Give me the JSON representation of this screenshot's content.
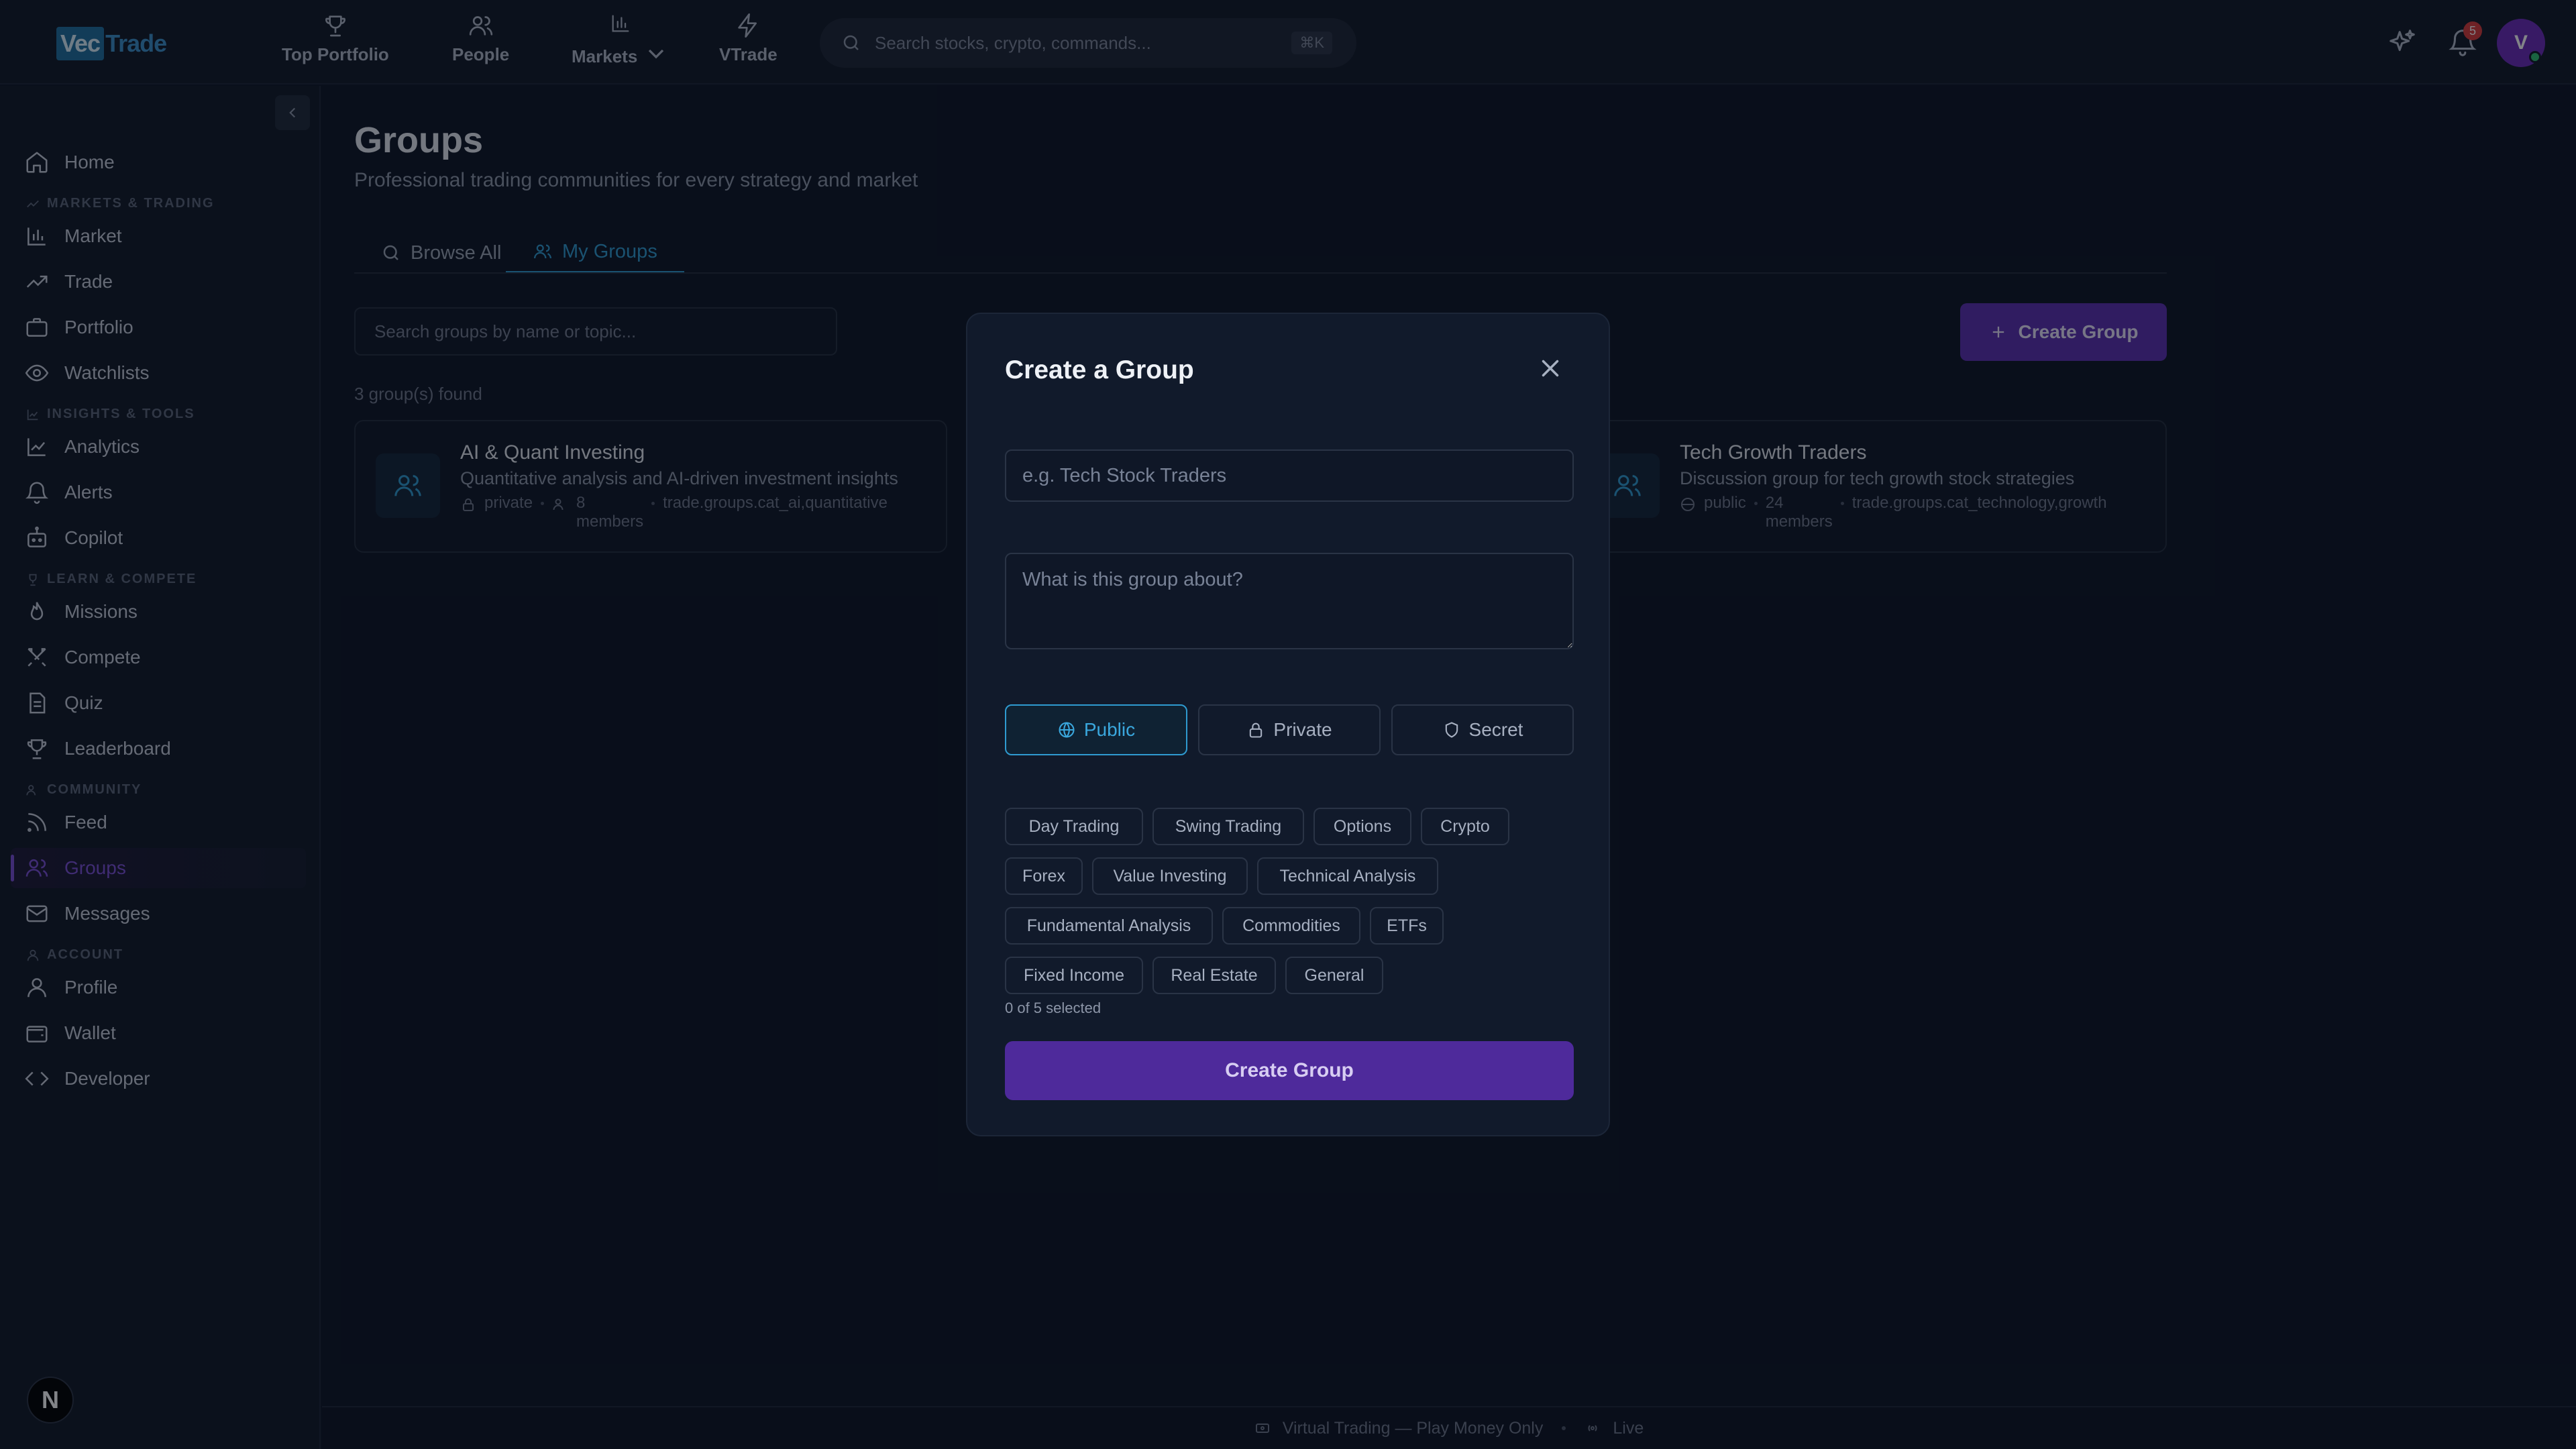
{
  "app": {
    "logo_vec": "Vec",
    "logo_trade": "Trade"
  },
  "topnav": {
    "items": [
      {
        "label": "Top Portfolio",
        "icon": "trophy-icon"
      },
      {
        "label": "People",
        "icon": "people-icon"
      },
      {
        "label": "Markets",
        "icon": "bar-chart-icon"
      },
      {
        "label": "VTrade",
        "icon": "lightning-icon"
      }
    ],
    "search_placeholder": "Search stocks, crypto, commands...",
    "search_shortcut": "⌘K",
    "notification_count": "5",
    "avatar_initial": "V"
  },
  "sidebar": {
    "home": "Home",
    "sections": {
      "markets": "MARKETS & TRADING",
      "insights": "INSIGHTS & TOOLS",
      "learn": "LEARN & COMPETE",
      "community": "COMMUNITY",
      "account": "ACCOUNT"
    },
    "items": {
      "market": "Market",
      "trade": "Trade",
      "portfolio": "Portfolio",
      "watchlists": "Watchlists",
      "analytics": "Analytics",
      "alerts": "Alerts",
      "copilot": "Copilot",
      "missions": "Missions",
      "compete": "Compete",
      "quiz": "Quiz",
      "leaderboard": "Leaderboard",
      "feed": "Feed",
      "groups": "Groups",
      "messages": "Messages",
      "profile": "Profile",
      "wallet": "Wallet",
      "developer": "Developer"
    },
    "bottom_badge": "N"
  },
  "main": {
    "title": "Groups",
    "subtitle": "Professional trading communities for every strategy and market",
    "tabs": {
      "browse": "Browse All",
      "mine": "My Groups"
    },
    "search_placeholder": "Search groups by name or topic...",
    "create_button": "Create Group",
    "found": "3 group(s) found",
    "cards": [
      {
        "title": "AI & Quant Investing",
        "desc": "Quantitative analysis and AI-driven investment insights",
        "visibility": "private",
        "members_count": "8",
        "members_label": "members",
        "category": "trade.groups.cat_ai,quantitative"
      },
      {
        "title": "Tech Growth Traders",
        "desc": "Discussion group for tech growth stock strategies",
        "visibility": "public",
        "members_count": "24",
        "members_label": "members",
        "category": "trade.groups.cat_technology,growth"
      }
    ]
  },
  "modal": {
    "title": "Create a Group",
    "name_placeholder": "e.g. Tech Stock Traders",
    "desc_placeholder": "What is this group about?",
    "visibility": {
      "public": "Public",
      "private": "Private",
      "secret": "Secret",
      "selected": "Public"
    },
    "tags": [
      "Day Trading",
      "Swing Trading",
      "Options",
      "Crypto",
      "Forex",
      "Value Investing",
      "Technical Analysis",
      "Fundamental Analysis",
      "Commodities",
      "ETFs",
      "Fixed Income",
      "Real Estate",
      "General"
    ],
    "selected_count": "0 of 5 selected",
    "submit": "Create Group"
  },
  "footer": {
    "mode": "Virtual Trading — Play Money Only",
    "status": "Live"
  },
  "colors": {
    "accent_purple": "#5b2fb0",
    "accent_blue": "#2f9bd1",
    "background": "#0d1424"
  }
}
